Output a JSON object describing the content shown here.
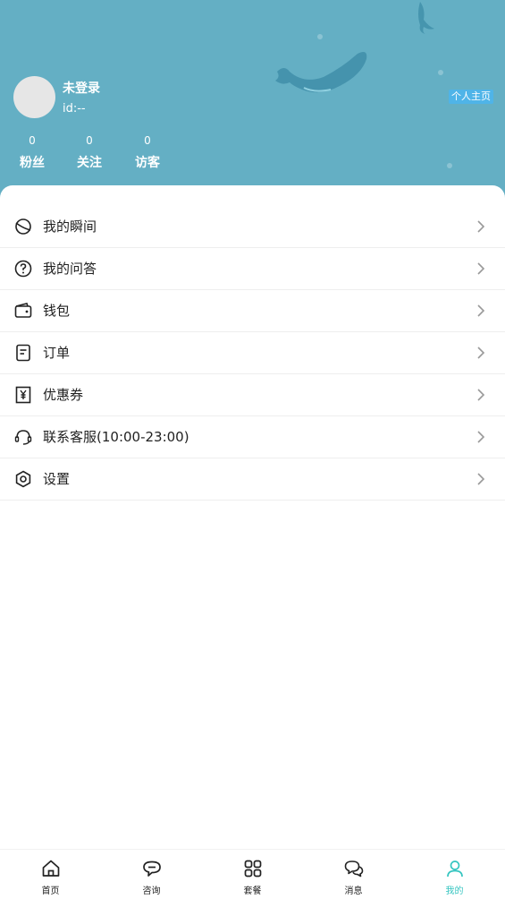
{
  "profile": {
    "username": "未登录",
    "user_id": "id:--",
    "homepage_label": "个人主页"
  },
  "stats": [
    {
      "value": "0",
      "label": "粉丝"
    },
    {
      "value": "0",
      "label": "关注"
    },
    {
      "value": "0",
      "label": "访客"
    }
  ],
  "menu": [
    {
      "label": "我的瞬间",
      "icon": "moments-icon"
    },
    {
      "label": "我的问答",
      "icon": "question-icon"
    },
    {
      "label": "钱包",
      "icon": "wallet-icon"
    },
    {
      "label": "订单",
      "icon": "order-icon"
    },
    {
      "label": "优惠券",
      "icon": "coupon-icon"
    },
    {
      "label": "联系客服(10:00-23:00)",
      "icon": "headset-icon"
    },
    {
      "label": "设置",
      "icon": "settings-icon"
    }
  ],
  "tabs": [
    {
      "label": "首页",
      "icon": "home-icon"
    },
    {
      "label": "咨询",
      "icon": "chat-icon"
    },
    {
      "label": "套餐",
      "icon": "grid-icon"
    },
    {
      "label": "消息",
      "icon": "messages-icon"
    },
    {
      "label": "我的",
      "icon": "user-icon",
      "active": true
    }
  ],
  "colors": {
    "header_bg": "#64afc4",
    "accent": "#35c5c0",
    "homepage_badge": "#4fb4e8"
  }
}
